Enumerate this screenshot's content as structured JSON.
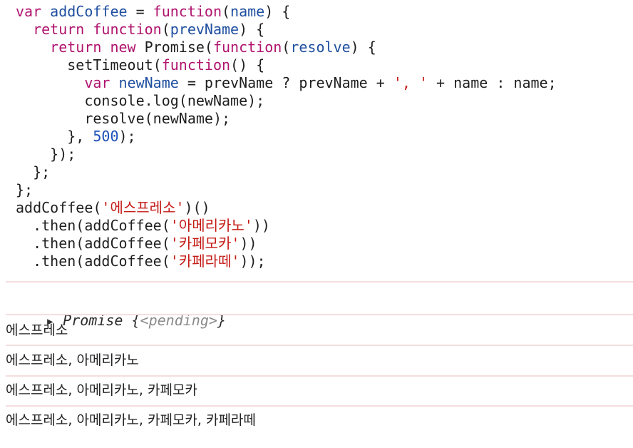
{
  "code_lines": [
    [
      {
        "t": "var",
        "c": "kw"
      },
      {
        "t": " "
      },
      {
        "t": "addCoffee",
        "c": "var"
      },
      {
        "t": " = "
      },
      {
        "t": "function",
        "c": "kw"
      },
      {
        "t": "("
      },
      {
        "t": "name",
        "c": "var"
      },
      {
        "t": ") {"
      }
    ],
    [
      {
        "t": "  "
      },
      {
        "t": "return",
        "c": "kw"
      },
      {
        "t": " "
      },
      {
        "t": "function",
        "c": "kw"
      },
      {
        "t": "("
      },
      {
        "t": "prevName",
        "c": "var"
      },
      {
        "t": ") {"
      }
    ],
    [
      {
        "t": "    "
      },
      {
        "t": "return",
        "c": "kw"
      },
      {
        "t": " "
      },
      {
        "t": "new",
        "c": "kw"
      },
      {
        "t": " Promise("
      },
      {
        "t": "function",
        "c": "kw"
      },
      {
        "t": "("
      },
      {
        "t": "resolve",
        "c": "var"
      },
      {
        "t": ") {"
      }
    ],
    [
      {
        "t": "      setTimeout("
      },
      {
        "t": "function",
        "c": "kw"
      },
      {
        "t": "() {"
      }
    ],
    [
      {
        "t": "        "
      },
      {
        "t": "var",
        "c": "kw"
      },
      {
        "t": " "
      },
      {
        "t": "newName",
        "c": "var"
      },
      {
        "t": " = prevName ? prevName + "
      },
      {
        "t": "', '",
        "c": "str"
      },
      {
        "t": " + name : name;"
      }
    ],
    [
      {
        "t": "        console.log(newName);"
      }
    ],
    [
      {
        "t": "        resolve(newName);"
      }
    ],
    [
      {
        "t": "      }, "
      },
      {
        "t": "500",
        "c": "num"
      },
      {
        "t": ");"
      }
    ],
    [
      {
        "t": "    });"
      }
    ],
    [
      {
        "t": "  };"
      }
    ],
    [
      {
        "t": "};"
      }
    ],
    [
      {
        "t": "addCoffee("
      },
      {
        "t": "'에스프레소'",
        "c": "str"
      },
      {
        "t": ")()"
      }
    ],
    [
      {
        "t": "  .then(addCoffee("
      },
      {
        "t": "'아메리카노'",
        "c": "str"
      },
      {
        "t": "))"
      }
    ],
    [
      {
        "t": "  .then(addCoffee("
      },
      {
        "t": "'카페모카'",
        "c": "str"
      },
      {
        "t": "))"
      }
    ],
    [
      {
        "t": "  .then(addCoffee("
      },
      {
        "t": "'카페라떼'",
        "c": "str"
      },
      {
        "t": "));"
      }
    ]
  ],
  "result": {
    "prefix": "Promise {",
    "state": "<pending>",
    "suffix": "}"
  },
  "logs": [
    "에스프레소",
    "에스프레소, 아메리카노",
    "에스프레소, 아메리카노, 카페모카",
    "에스프레소, 아메리카노, 카페모카, 카페라떼"
  ],
  "colors": {
    "keyword": "#b0136e",
    "identifier": "#1f4fa0",
    "string": "#c41a16",
    "number": "#1c4fb8",
    "separator": "#f5dede"
  }
}
